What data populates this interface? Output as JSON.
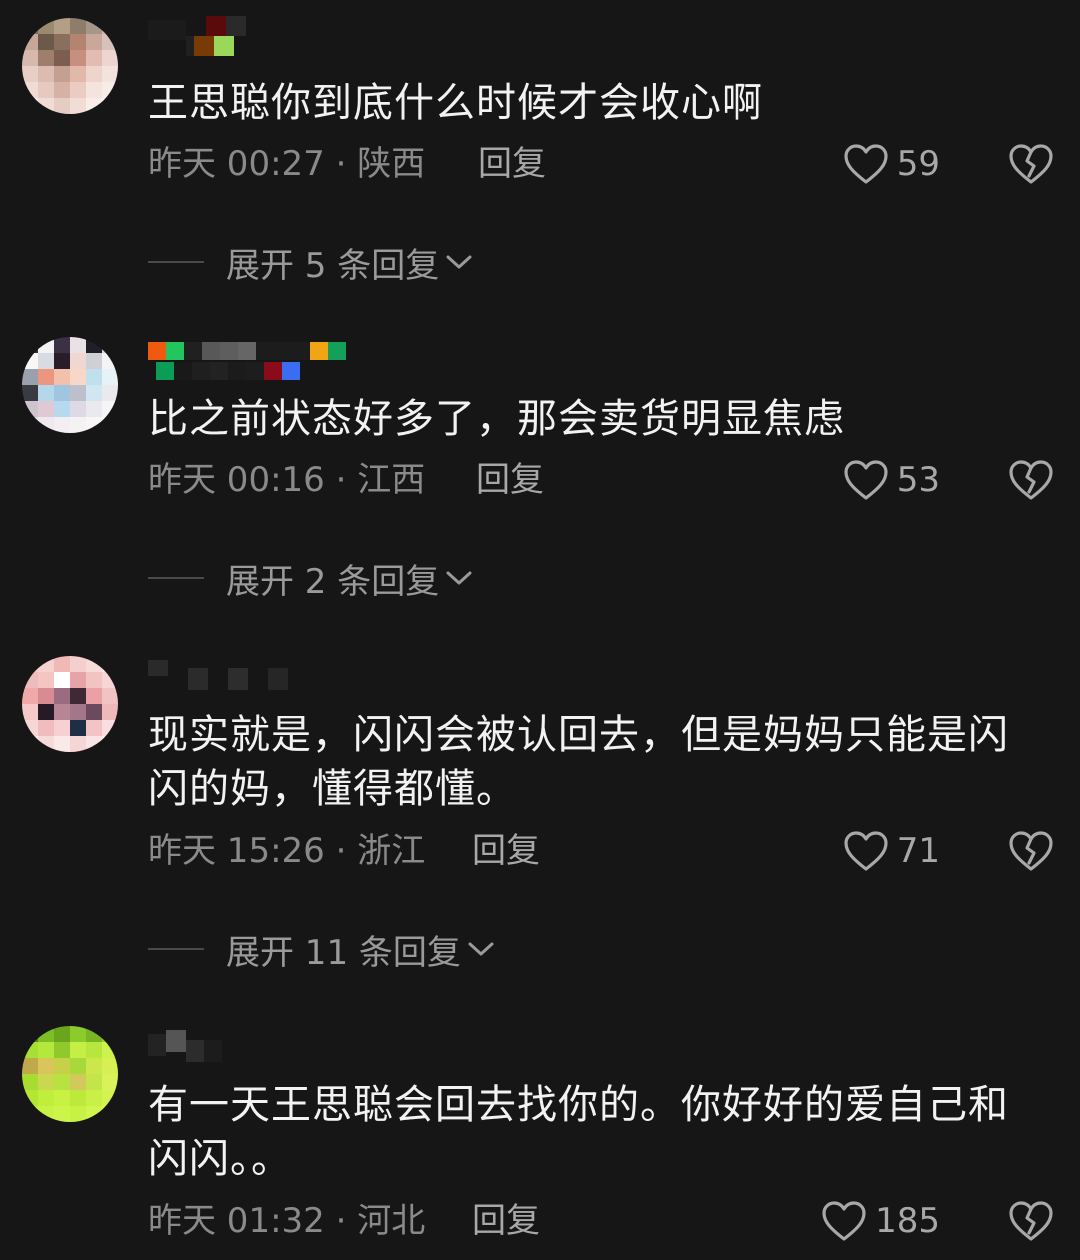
{
  "comments": [
    {
      "text": "王思聪你到底什么时候才会收心啊",
      "time": "昨天 00:27 · 陕西",
      "reply_label": "回复",
      "likes": "59",
      "expand_label": "展开 5 条回复"
    },
    {
      "text": "比之前状态好多了，那会卖货明显焦虑",
      "time": "昨天 00:16 · 江西",
      "reply_label": "回复",
      "likes": "53",
      "expand_label": "展开 2 条回复"
    },
    {
      "text": "现实就是，闪闪会被认回去，但是妈妈只能是闪闪的妈，懂得都懂。",
      "time": "昨天 15:26 · 浙江",
      "reply_label": "回复",
      "likes": "71",
      "expand_label": "展开 11 条回复"
    },
    {
      "text": "有一天王思聪会回去找你的。你好好的爱自己和闪闪。。",
      "time": "昨天 01:32 · 河北",
      "reply_label": "回复",
      "likes": "185"
    }
  ],
  "icons": {
    "like": "heart-outline-icon",
    "dislike": "broken-heart-icon",
    "expand": "chevron-down-icon"
  },
  "colors": {
    "background": "#161616",
    "text": "#f2f2f2",
    "meta": "#8a8a8a",
    "action": "#a8a8a8"
  }
}
